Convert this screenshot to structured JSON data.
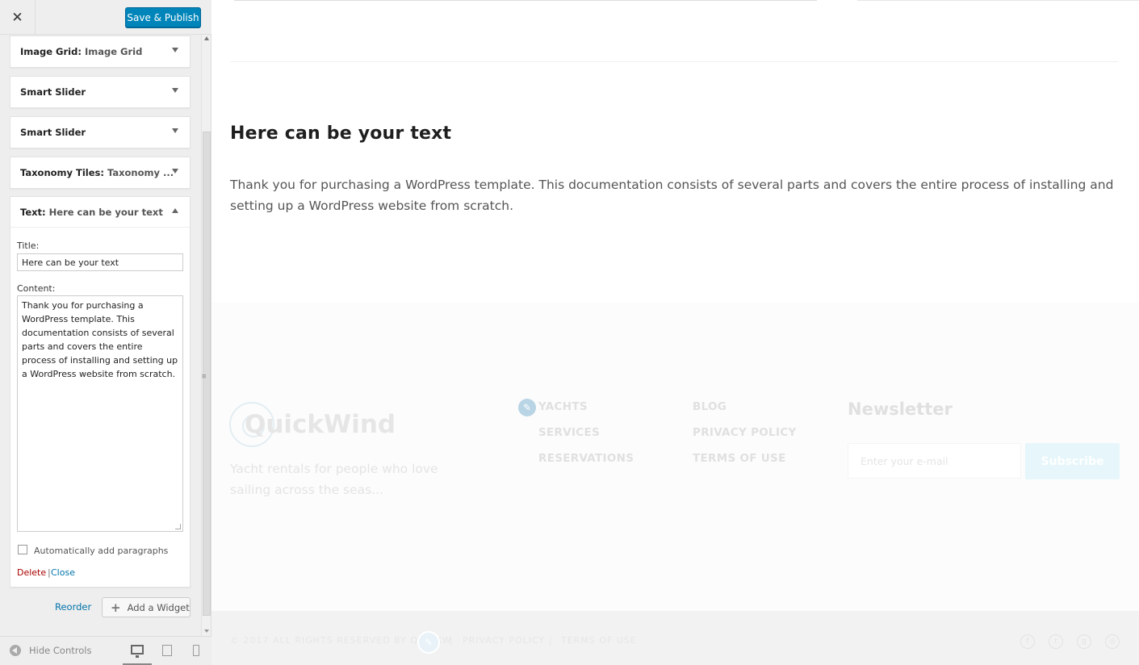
{
  "customizer": {
    "close_glyph": "✕",
    "publish_label": "Save & Publish",
    "widgets": [
      {
        "name": "Image Grid:",
        "subtitle": "Image Grid"
      },
      {
        "name": "Smart Slider",
        "subtitle": ""
      },
      {
        "name": "Smart Slider",
        "subtitle": ""
      },
      {
        "name": "Taxonomy Tiles:",
        "subtitle": "Taxonomy ..."
      },
      {
        "name": "Text:",
        "subtitle": "Here can be your text"
      }
    ],
    "text_widget": {
      "title_label": "Title:",
      "title_value": "Here can be your text",
      "content_label": "Content:",
      "content_value": "Thank you for purchasing a WordPress template. This documentation consists of several parts and covers the entire process of installing and setting up a WordPress website from scratch.",
      "autop_label": "Automatically add paragraphs",
      "autop_checked": false,
      "delete_label": "Delete",
      "separator": "|",
      "close_label": "Close"
    },
    "reorder_label": "Reorder",
    "add_widget_label": "Add a Widget",
    "hide_controls_label": "Hide Controls",
    "preview_device": "desktop",
    "accent_color": "#0085ba"
  },
  "preview": {
    "heading": "Here can be your text",
    "body": "Thank you for purchasing a WordPress template. This documentation consists of several parts and covers the entire process of installing and setting up a WordPress website from scratch.",
    "footer": {
      "logo": "QuickWind",
      "tagline": "Yacht rentals for people who love sailing across the seas...",
      "links_col1": [
        "YACHTS",
        "SERVICES",
        "RESERVATIONS"
      ],
      "links_col2": [
        "BLOG",
        "PRIVACY POLICY",
        "TERMS OF USE"
      ],
      "newsletter_title": "Newsletter",
      "email_placeholder": "Enter your e-mail",
      "subscribe_label": "Subscribe"
    },
    "bottom": {
      "copyright": "© 2017 ALL RIGHTS RESERVED BY QUICKW",
      "divider": "|",
      "privacy": "PRIVACY POLICY",
      "terms": "TERMS OF USE",
      "social_icons": [
        "facebook-icon",
        "twitter-icon",
        "google-plus-icon",
        "instagram-icon"
      ]
    }
  }
}
